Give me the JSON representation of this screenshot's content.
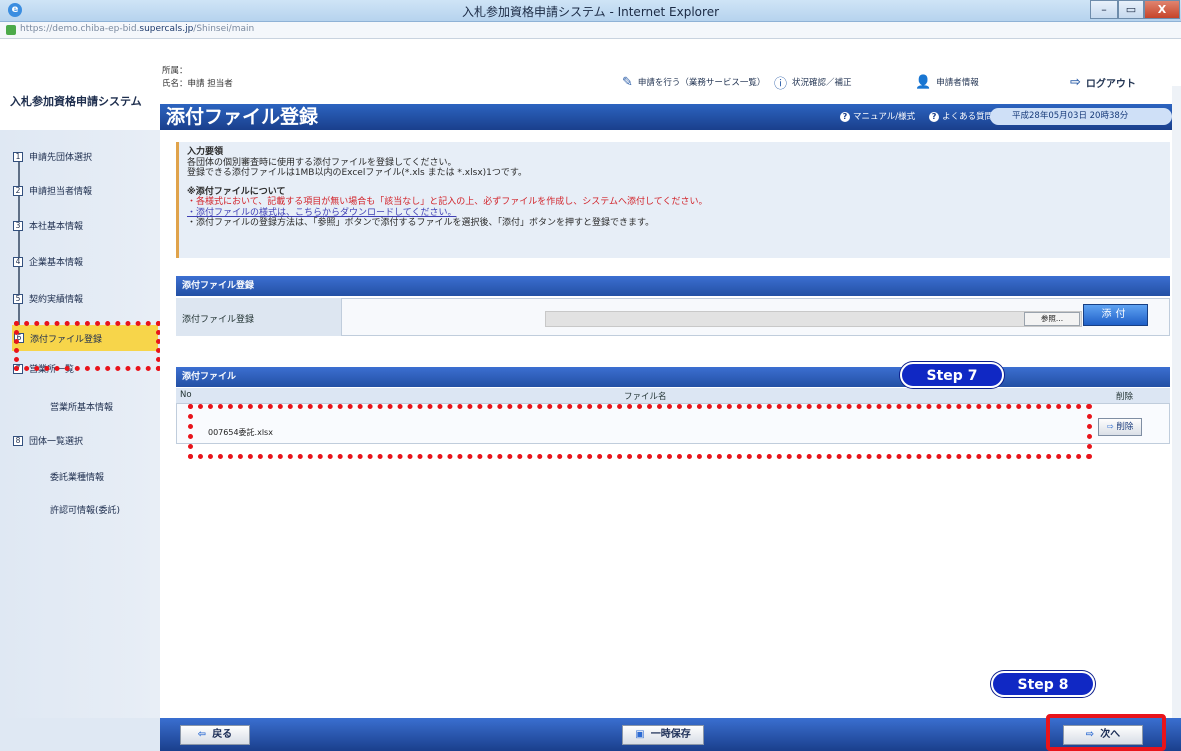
{
  "window": {
    "title": "入札参加資格申請システム - Internet Explorer",
    "min": "–",
    "max": "▭",
    "close": "X"
  },
  "address": {
    "url_prefix": "https://demo.chiba-ep-bid.",
    "url_domain": "supercals.jp",
    "url_path": "/Shinsei/main"
  },
  "header": {
    "app_name": "入札参加資格申請システム",
    "dept_label": "所属：",
    "name_label": "氏名：申請 担当者",
    "nav_apply": "申請を行う（業務サービス一覧）",
    "nav_status": "状況確認／補正",
    "nav_info": "申請者情報",
    "nav_logout": "ログアウト"
  },
  "page": {
    "title": "添付ファイル登録",
    "help_manual": "マニュアル/様式",
    "help_faq": "よくある質問",
    "date": "平成28年05月03日 20時38分"
  },
  "sidebar": {
    "items": [
      {
        "num": "1",
        "label": "申請先団体選択"
      },
      {
        "num": "2",
        "label": "申請担当者情報"
      },
      {
        "num": "3",
        "label": "本社基本情報"
      },
      {
        "num": "4",
        "label": "企業基本情報"
      },
      {
        "num": "5",
        "label": "契約実績情報"
      },
      {
        "num": "6",
        "label": "添付ファイル登録"
      },
      {
        "num": "7",
        "label": "営業所一覧"
      },
      {
        "num": "",
        "label": "営業所基本情報"
      },
      {
        "num": "8",
        "label": "団体一覧選択"
      },
      {
        "num": "",
        "label": "委託業種情報"
      },
      {
        "num": "",
        "label": "許認可情報(委託)"
      }
    ]
  },
  "notice": {
    "heading": "入力要領",
    "line1": "各団体の個別審査時に使用する添付ファイルを登録してください。",
    "line2": "登録できる添付ファイルは1MB以内のExcelファイル(*.xls または *.xlsx)1つです。",
    "heading2": "※添付ファイルについて",
    "red1": "・各様式において、記載する項目が無い場合も「該当なし」と記入の上、必ずファイルを作成し、システムへ添付してください。",
    "red2": "・添付ファイルの様式は、こちらからダウンロードしてください。",
    "line3": "・添付ファイルの登録方法は、「参照」ボタンで添付するファイルを選択後、「添付」ボタンを押すと登録できます。"
  },
  "register": {
    "section": "添付ファイル登録",
    "label": "添付ファイル登録",
    "browse": "参照...",
    "attach": "添付"
  },
  "files": {
    "section": "添付ファイル",
    "col_no": "No",
    "col_name": "ファイル名",
    "col_delete": "削除",
    "rows": [
      {
        "name": "007654委託.xlsx",
        "delete": "削除"
      }
    ]
  },
  "steps": {
    "step7": "Step 7",
    "step8": "Step 8"
  },
  "footer": {
    "back": "戻る",
    "save": "一時保存",
    "next": "次へ"
  },
  "colors": {
    "accent": "#1a3f8c",
    "highlight": "#e8141b",
    "step": "#1028c4",
    "active": "#f7d54a"
  }
}
